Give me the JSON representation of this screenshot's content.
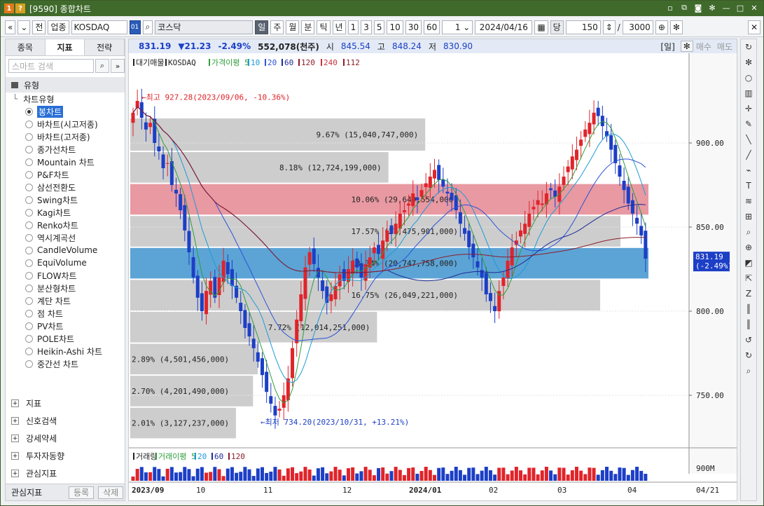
{
  "titlebar": {
    "badge1": "1",
    "badge2": "?",
    "title": "[9590] 종합차트"
  },
  "toolbar": {
    "btn_jeon": "전",
    "btn_upjong": "업종",
    "code": "KOSDAQ",
    "code_box": "01",
    "name": "코스닥",
    "periods": [
      "일",
      "주",
      "월",
      "분",
      "틱",
      "년"
    ],
    "intervals": [
      "1",
      "3",
      "5",
      "10",
      "30",
      "60"
    ],
    "count1": "1",
    "date": "2024/04/16",
    "label_dang": "당",
    "count2": "150",
    "slash": "/",
    "count3": "3000"
  },
  "leftpanel": {
    "tabs": [
      "종목",
      "지표",
      "전략"
    ],
    "search_placeholder": "스마트 검색",
    "group_label": "유형",
    "sub_label": "차트유형",
    "items": [
      "봉차트",
      "바차트(시고저종)",
      "바차트(고저종)",
      "종가선차트",
      "Mountain 차트",
      "P&F차트",
      "삼선전환도",
      "Swing차트",
      "Kagi차트",
      "Renko차트",
      "역시계곡선",
      "CandleVolume",
      "EquiVolume",
      "FLOW차트",
      "분산형차트",
      "계단 차트",
      "점 차트",
      "PV차트",
      "POLE차트",
      "Heikin-Ashi 차트",
      "중간선 차트"
    ],
    "bottom": [
      "지표",
      "신호검색",
      "강세약세",
      "투자자동향",
      "관심지표"
    ],
    "fav_label": "관심지표",
    "fav_add": "등록",
    "fav_del": "삭제"
  },
  "pricebar": {
    "last": "831.19",
    "change": "▼21.23",
    "pct": "-2.49%",
    "vol": "552,078(천주)",
    "o_lbl": "시",
    "o": "845.54",
    "h_lbl": "고",
    "h": "848.24",
    "l_lbl": "저",
    "l": "830.90",
    "period": "[일]",
    "buy": "매수",
    "sell": "매도"
  },
  "legend": {
    "a": "대기매물",
    "b": "KOSDAQ",
    "c": "가격이평 5",
    "d": "10",
    "e": "20",
    "f": "60",
    "g": "120",
    "h": "240",
    "i": "112"
  },
  "vol_legend": {
    "a": "거래량",
    "b": "거래이평 5",
    "c": "20",
    "d": "60",
    "e": "120"
  },
  "annotations": {
    "high": "←최고 927.28(2023/09/06, -10.36%)",
    "low": "←최저 734.20(2023/10/31, +13.21%)"
  },
  "price_tag": {
    "price": "831.19",
    "pct": "(-2.49%)"
  },
  "vol_axis_label": "900M",
  "date_end": "04/21",
  "colors": {
    "up": "#e0242a",
    "down": "#1c3fc6",
    "ma5": "#2e9e3a",
    "ma10": "#1d9bd6",
    "ma20": "#2b52d8",
    "ma60": "#1d2a96",
    "ma120": "#8d1c2a",
    "ma240": "#c4343c",
    "band_red": "#e68e98",
    "band_blue": "#4a9ad0",
    "band_gray": "#c8c8c8"
  },
  "chart_data": {
    "type": "candlestick",
    "y_ticks": [
      750,
      800,
      850,
      900
    ],
    "ylim": [
      720,
      945
    ],
    "x_ticks": [
      "2023/09",
      "10",
      "11",
      "12",
      "2024/01",
      "02",
      "03",
      "04"
    ],
    "volume_profile": [
      {
        "from": 895,
        "to": 915,
        "label": "9.67% (15,040,747,000)",
        "share": 9.67
      },
      {
        "from": 876,
        "to": 895,
        "label": "8.18% (12,724,199,000)",
        "share": 8.18
      },
      {
        "from": 857,
        "to": 876,
        "label": "10.06% (29,649,554,000)",
        "share": 10.06,
        "highlight": "red"
      },
      {
        "from": 838,
        "to": 857,
        "label": "17.57% (27,475,901,000)",
        "share": 17.57
      },
      {
        "from": 819,
        "to": 838,
        "label": "13.34% (20,747,758,000)",
        "share": 13.34,
        "highlight": "blue"
      },
      {
        "from": 800,
        "to": 819,
        "label": "16.75% (26,049,221,000)",
        "share": 16.75
      },
      {
        "from": 781,
        "to": 800,
        "label": "7.72% (12,014,251,000)",
        "share": 7.72
      },
      {
        "from": 762,
        "to": 781,
        "label": "2.89% (4,501,456,000)",
        "share": 2.89
      },
      {
        "from": 743,
        "to": 762,
        "label": "2.70% (4,201,490,000)",
        "share": 2.7
      },
      {
        "from": 724,
        "to": 743,
        "label": "2.01% (3,127,237,000)",
        "share": 2.01
      }
    ],
    "closes": [
      918,
      925,
      915,
      908,
      912,
      900,
      895,
      885,
      888,
      875,
      870,
      860,
      848,
      835,
      820,
      808,
      800,
      812,
      818,
      808,
      820,
      830,
      822,
      815,
      808,
      800,
      790,
      785,
      778,
      770,
      762,
      752,
      745,
      738,
      742,
      750,
      760,
      778,
      795,
      810,
      826,
      835,
      828,
      820,
      812,
      805,
      810,
      815,
      822,
      818,
      825,
      830,
      826,
      820,
      828,
      832,
      838,
      834,
      842,
      848,
      846,
      852,
      858,
      860,
      864,
      870,
      866,
      872,
      876,
      880,
      884,
      878,
      874,
      870,
      866,
      860,
      852,
      846,
      838,
      832,
      826,
      820,
      810,
      806,
      800,
      812,
      820,
      830,
      838,
      842,
      848,
      852,
      858,
      862,
      866,
      864,
      870,
      872,
      868,
      874,
      880,
      886,
      892,
      896,
      902,
      908,
      912,
      918,
      916,
      910,
      904,
      896,
      888,
      880,
      872,
      864,
      858,
      852,
      845,
      831.19
    ],
    "last_close": 831.19
  }
}
